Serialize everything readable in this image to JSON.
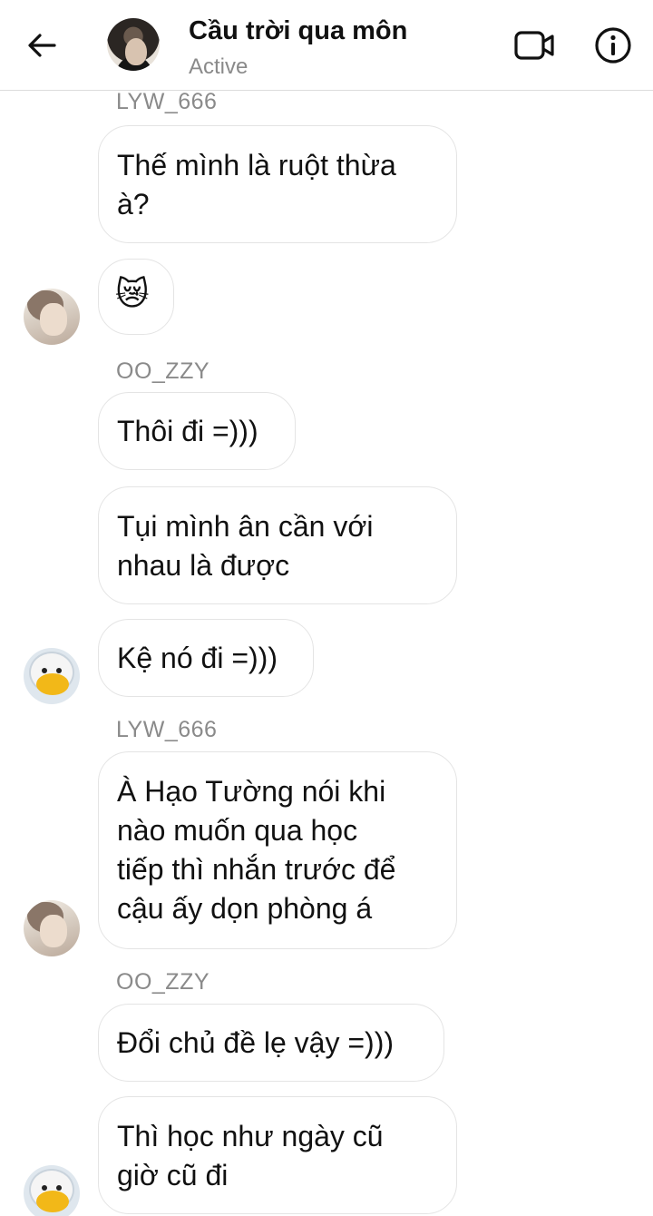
{
  "header": {
    "title": "Cầu trời qua môn",
    "status": "Active",
    "back_icon": "arrow-left-icon",
    "video_icon": "video-camera-icon",
    "info_icon": "info-icon"
  },
  "messages": [
    {
      "sender": "LYW_666",
      "text": "Thế mình là ruột thừa\nà?"
    },
    {
      "text": "😿"
    },
    {
      "sender": "OO_ZZY",
      "text": "Thôi đi =)))"
    },
    {
      "text": "Tụi mình ân cần với\nnhau là được"
    },
    {
      "text": "Kệ nó đi =)))"
    },
    {
      "sender": "LYW_666",
      "text": "À Hạo Tường nói khi\nnào muốn qua học\ntiếp thì nhắn trước để\ncậu ấy dọn phòng á"
    },
    {
      "sender": "OO_ZZY",
      "text": "Đổi chủ đề lẹ vậy =)))"
    },
    {
      "text": "Thì học như ngày cũ\ngiờ cũ đi"
    }
  ]
}
